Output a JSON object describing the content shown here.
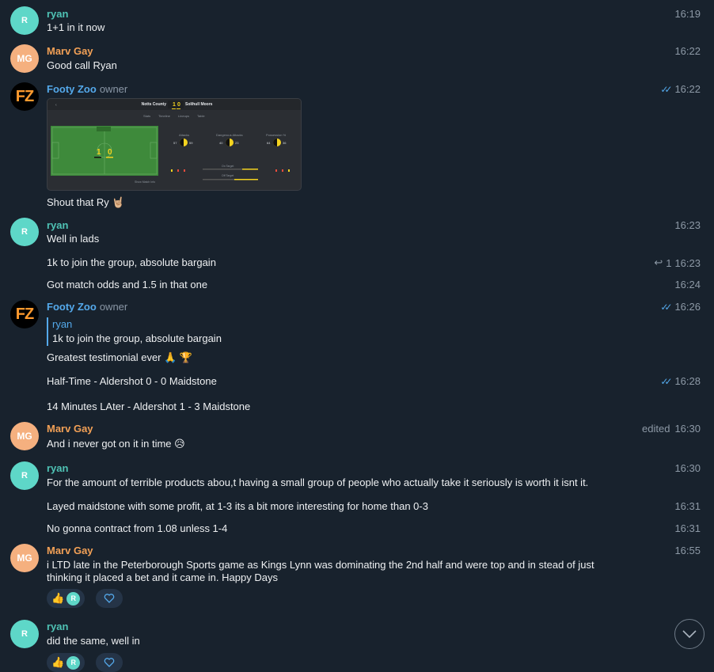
{
  "messages": [
    {
      "author": "ryan",
      "initials": "R",
      "text": "1+1 in it now",
      "time": "16:19"
    },
    {
      "author": "Marv Gay",
      "initials": "MG",
      "text": "Good call Ryan",
      "time": "16:22"
    },
    {
      "author": "Footy Zoo",
      "badge": "owner",
      "initials": "FZ",
      "time": "16:22",
      "caption": "Shout that Ry 🤘🏼",
      "screenshot": {
        "home": "Notts County",
        "away": "Solihull Moors",
        "score_home": "1",
        "score_away": "0",
        "tabs": [
          "Stats",
          "Timeline",
          "Lineups",
          "Table"
        ],
        "stats": [
          "Attacks",
          "Dangerous Attacks",
          "Possession %"
        ],
        "attacks": [
          "57",
          "59"
        ],
        "dangerous": [
          "40",
          "23"
        ],
        "possession": [
          "64",
          "36"
        ],
        "on_target": "On Target",
        "off_target": "Off Target",
        "show_info": "Show Match Info"
      }
    },
    {
      "author": "ryan",
      "initials": "R",
      "text": "Well in lads",
      "time": "16:23"
    },
    {
      "text": "1k to join the group, absolute bargain",
      "time": "16:23",
      "reply_count": "1"
    },
    {
      "text": "Got match odds and 1.5 in that one",
      "time": "16:24"
    },
    {
      "author": "Footy Zoo",
      "badge": "owner",
      "initials": "FZ",
      "time": "16:26",
      "quote_author": "ryan",
      "quote_text": "1k to join the group, absolute bargain",
      "text": "Greatest testimonial ever 🙏 🏆"
    },
    {
      "text": "Half-Time - Aldershot 0 - 0 Maidstone",
      "time": "16:28"
    },
    {
      "text": "14 Minutes LAter - Aldershot 1 - 3 Maidstone"
    },
    {
      "author": "Marv Gay",
      "initials": "MG",
      "text": "And i never got  on it in time 😥",
      "time": "16:30",
      "edited": "edited"
    },
    {
      "author": "ryan",
      "initials": "R",
      "text": "For the amount of terrible products abou,t having a small group of people who actually take it seriously is worth it isnt it.",
      "time": "16:30"
    },
    {
      "text": "Layed maidstone with some profit, at 1-3 its a bit more interesting for home than 0-3",
      "time": "16:31"
    },
    {
      "text": "No gonna contract from 1.08 unless 1-4",
      "time": "16:31"
    },
    {
      "author": "Marv Gay",
      "initials": "MG",
      "text_line1": "i LTD late in the Peterborough Sports game as Kings Lynn was dominating the 2nd half and were top and in stead of just",
      "text_line2": "thinking it placed a bet and it came in. Happy Days",
      "time": "16:55",
      "reaction": "👍",
      "reaction_user": "R"
    },
    {
      "author": "ryan",
      "initials": "R",
      "text": "did the same, well in",
      "reaction": "👍",
      "reaction_user": "R"
    }
  ],
  "colors": {
    "bg": "#18222d",
    "ryan": "#4fc3b5",
    "marv": "#f2a056",
    "footy": "#54a9eb"
  }
}
